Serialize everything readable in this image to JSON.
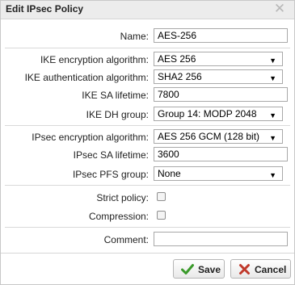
{
  "dialog": {
    "title": "Edit IPsec Policy",
    "close_glyph": "✕"
  },
  "form": {
    "name": {
      "label": "Name:",
      "value": "AES-256"
    },
    "ike_encryption": {
      "label": "IKE encryption algorithm:",
      "value": "AES 256"
    },
    "ike_authentication": {
      "label": "IKE authentication algorithm:",
      "value": "SHA2 256"
    },
    "ike_sa_lifetime": {
      "label": "IKE SA lifetime:",
      "value": "7800"
    },
    "ike_dh_group": {
      "label": "IKE DH group:",
      "value": "Group 14: MODP 2048"
    },
    "ipsec_encryption": {
      "label": "IPsec encryption algorithm:",
      "value": "AES 256 GCM (128 bit)"
    },
    "ipsec_sa_lifetime": {
      "label": "IPsec SA lifetime:",
      "value": "3600"
    },
    "ipsec_pfs_group": {
      "label": "IPsec PFS group:",
      "value": "None"
    },
    "strict_policy": {
      "label": "Strict policy:",
      "checked": false
    },
    "compression": {
      "label": "Compression:",
      "checked": false
    },
    "comment": {
      "label": "Comment:",
      "value": ""
    }
  },
  "buttons": {
    "save": {
      "label": "Save",
      "icon": "checkmark-icon",
      "icon_color": "#3a9a2a"
    },
    "cancel": {
      "label": "Cancel",
      "icon": "x-icon",
      "icon_color": "#c0392b"
    }
  },
  "dropdown_glyph": "▼"
}
